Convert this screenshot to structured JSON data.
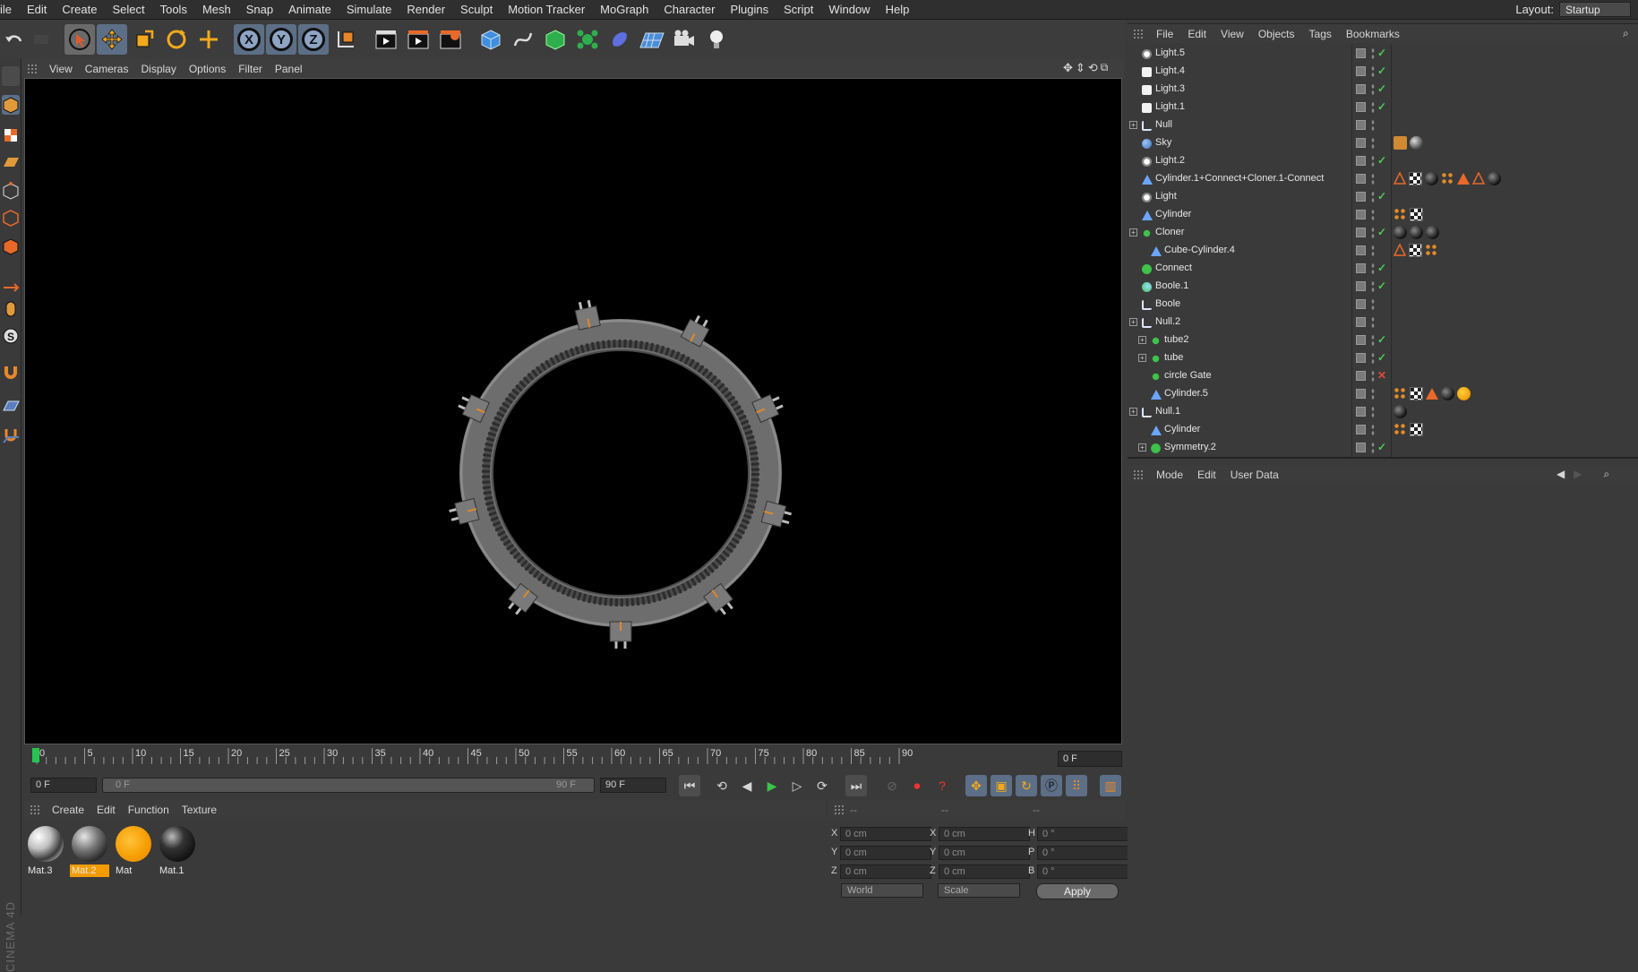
{
  "menu": [
    "ile",
    "Edit",
    "Create",
    "Select",
    "Tools",
    "Mesh",
    "Snap",
    "Animate",
    "Simulate",
    "Render",
    "Sculpt",
    "Motion Tracker",
    "MoGraph",
    "Character",
    "Plugins",
    "Script",
    "Window",
    "Help"
  ],
  "layout": {
    "label": "Layout:",
    "value": "Startup"
  },
  "toolbar": {
    "axis_x": "X",
    "axis_y": "Y",
    "axis_z": "Z"
  },
  "viewport_menu": [
    "View",
    "Cameras",
    "Display",
    "Options",
    "Filter",
    "Panel"
  ],
  "timeline": {
    "ticks": [
      "0",
      "5",
      "10",
      "15",
      "20",
      "25",
      "30",
      "35",
      "40",
      "45",
      "50",
      "55",
      "60",
      "65",
      "70",
      "75",
      "80",
      "85",
      "90"
    ],
    "current_frame": "0 F",
    "start_field": "0 F",
    "range_start": "0 F",
    "range_end": "90 F",
    "end_field": "90 F"
  },
  "material_menu": [
    "Create",
    "Edit",
    "Function",
    "Texture"
  ],
  "materials": [
    {
      "name": "Mat.3",
      "kind": "chrome",
      "selected": false
    },
    {
      "name": "Mat.2",
      "kind": "metal",
      "selected": true
    },
    {
      "name": "Mat",
      "kind": "orange",
      "selected": false
    },
    {
      "name": "Mat.1",
      "kind": "dark",
      "selected": false
    }
  ],
  "coordinates": {
    "header": [
      "--",
      "--",
      "--"
    ],
    "pos": [
      {
        "axis": "X",
        "value": "0 cm"
      },
      {
        "axis": "Y",
        "value": "0 cm"
      },
      {
        "axis": "Z",
        "value": "0 cm"
      }
    ],
    "size": [
      {
        "axis": "X",
        "value": "0 cm"
      },
      {
        "axis": "Y",
        "value": "0 cm"
      },
      {
        "axis": "Z",
        "value": "0 cm"
      }
    ],
    "rot": [
      {
        "axis": "H",
        "value": "0 °"
      },
      {
        "axis": "P",
        "value": "0 °"
      },
      {
        "axis": "B",
        "value": "0 °"
      }
    ],
    "mode1": "World",
    "mode2": "Scale",
    "apply": "Apply"
  },
  "objects_menu": [
    "File",
    "Edit",
    "View",
    "Objects",
    "Tags",
    "Bookmarks"
  ],
  "objects": [
    {
      "name": "Light.5",
      "depth": 0,
      "icon": "light-icon",
      "check": "green",
      "tags": []
    },
    {
      "name": "Light.4",
      "depth": 0,
      "icon": "area-light-icon",
      "check": "green",
      "tags": []
    },
    {
      "name": "Light.3",
      "depth": 0,
      "icon": "area-light-icon",
      "check": "green",
      "tags": []
    },
    {
      "name": "Light.1",
      "depth": 0,
      "icon": "area-light-icon",
      "check": "green",
      "tags": []
    },
    {
      "name": "Null",
      "depth": 0,
      "icon": "null-icon",
      "check": "none",
      "expand": true,
      "tags": []
    },
    {
      "name": "Sky",
      "depth": 0,
      "icon": "sky-icon",
      "check": "none",
      "tags": [
        "cam",
        "tx"
      ]
    },
    {
      "name": "Light.2",
      "depth": 0,
      "icon": "light-icon",
      "check": "green",
      "tags": []
    },
    {
      "name": "Cylinder.1+Connect+Cloner.1-Connect",
      "depth": 0,
      "icon": "polygon-icon",
      "check": "none",
      "tags": [
        "trio",
        "ph",
        "dk",
        "dot3",
        "tri",
        "trio",
        "dk"
      ]
    },
    {
      "name": "Light",
      "depth": 0,
      "icon": "light-icon",
      "check": "green",
      "tags": []
    },
    {
      "name": "Cylinder",
      "depth": 0,
      "icon": "polygon-icon",
      "check": "none",
      "tags": [
        "dot3",
        "ph"
      ]
    },
    {
      "name": "Cloner",
      "depth": 0,
      "icon": "cloner-icon",
      "check": "green",
      "expand": true,
      "tags": [
        "dk",
        "dk",
        "dk"
      ]
    },
    {
      "name": "Cube-Cylinder.4",
      "depth": 1,
      "icon": "polygon-icon",
      "check": "none",
      "tags": [
        "trio",
        "ph",
        "dot3"
      ]
    },
    {
      "name": "Connect",
      "depth": 0,
      "icon": "connect-icon",
      "check": "green",
      "tags": []
    },
    {
      "name": "Boole.1",
      "depth": 0,
      "icon": "boole-icon",
      "check": "green",
      "tags": []
    },
    {
      "name": "Boole",
      "depth": 0,
      "icon": "null-icon",
      "check": "none",
      "tags": []
    },
    {
      "name": "Null.2",
      "depth": 0,
      "icon": "null-icon",
      "check": "none",
      "expand": true,
      "tags": []
    },
    {
      "name": "tube2",
      "depth": 1,
      "icon": "cloner-icon",
      "check": "green",
      "expand": true,
      "tags": []
    },
    {
      "name": "tube",
      "depth": 1,
      "icon": "cloner-icon",
      "check": "green",
      "expand": true,
      "tags": []
    },
    {
      "name": "circle Gate",
      "depth": 1,
      "icon": "cloner-icon",
      "check": "red",
      "tags": []
    },
    {
      "name": "Cylinder.5",
      "depth": 1,
      "icon": "polygon-icon",
      "check": "none",
      "tags": [
        "dot3",
        "ph",
        "tri",
        "dk",
        "or"
      ]
    },
    {
      "name": "Null.1",
      "depth": 0,
      "icon": "null-icon",
      "check": "none",
      "expand": true,
      "tags": [
        "dk"
      ]
    },
    {
      "name": "Cylinder",
      "depth": 1,
      "icon": "polygon-icon",
      "check": "none",
      "tags": [
        "dot3",
        "ph"
      ]
    },
    {
      "name": "Symmetry.2",
      "depth": 1,
      "icon": "symmetry-icon",
      "check": "green",
      "expand": true,
      "tags": []
    }
  ],
  "attributes_menu": [
    "Mode",
    "Edit",
    "User Data"
  ],
  "brand": "CINEMA 4D"
}
